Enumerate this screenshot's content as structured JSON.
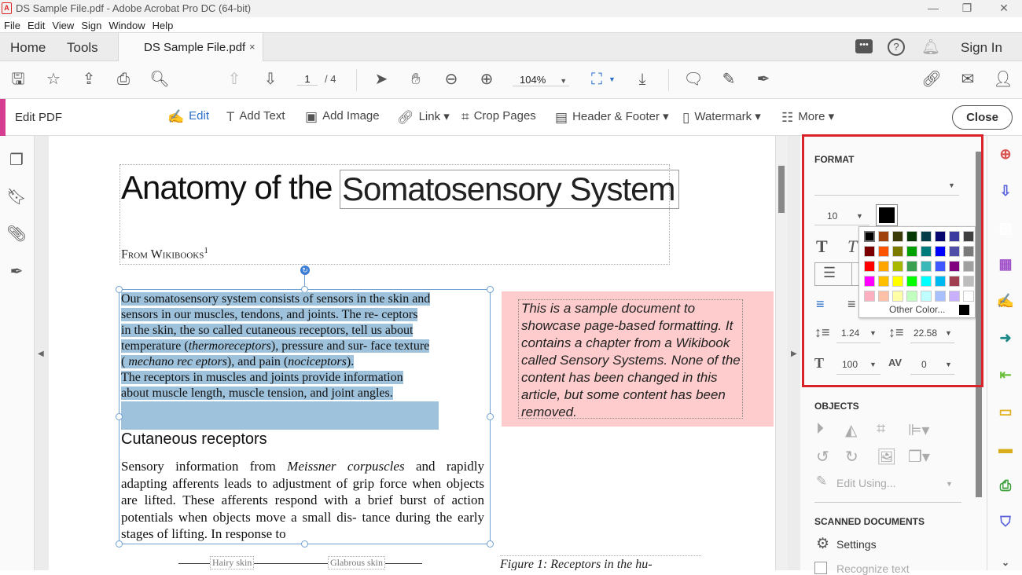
{
  "window": {
    "title": "DS Sample File.pdf - Adobe Acrobat Pro DC (64-bit)",
    "controls": [
      "minimize",
      "restore",
      "close"
    ]
  },
  "menu": [
    "File",
    "Edit",
    "View",
    "Sign",
    "Window",
    "Help"
  ],
  "tabs": {
    "home": "Home",
    "tools": "Tools",
    "document": "DS Sample File.pdf",
    "close_glyph": "×",
    "sign_in": "Sign In"
  },
  "toolbar": {
    "page_current": "1",
    "page_total": "/ 4",
    "zoom": "104%"
  },
  "edit_bar": {
    "title": "Edit PDF",
    "tools": [
      {
        "label": "Edit",
        "icon": "edit-icon",
        "active": true
      },
      {
        "label": "Add Text",
        "icon": "add-text-icon"
      },
      {
        "label": "Add Image",
        "icon": "add-image-icon"
      },
      {
        "label": "Link ▾",
        "icon": "link-icon"
      },
      {
        "label": "Crop Pages",
        "icon": "crop-pages-icon"
      },
      {
        "label": "Header & Footer ▾",
        "icon": "header-footer-icon"
      },
      {
        "label": "Watermark ▾",
        "icon": "watermark-icon"
      },
      {
        "label": "More ▾",
        "icon": "more-icon"
      }
    ],
    "close_label": "Close",
    "accent_color": "#d63c8f"
  },
  "document": {
    "title_part1": "Anatomy of the",
    "title_part2": "Somatosensory System",
    "byline": "From Wikibooks",
    "byline_sup": "1",
    "para1": {
      "l1": "Our somatosensory system consists of  sensors in the skin  and",
      "l2": "sensors in our  muscles, tendons, and  joints. The re- ceptors",
      "l3": "in the skin, the so  called cutaneous receptors,  tell  us about",
      "l4a": "temperature (",
      "l4i": "thermoreceptors",
      "l4b": "),  pressure and sur- face  texture",
      "l5a": "( ",
      "l5i": "mechano rec eptors",
      "l5b": "),  and  pain  (",
      "l5i2": "nociceptors",
      "l5c": ").",
      "l6": "The receptors in muscles and joints provide  information",
      "l7": "about muscle length, muscle   tension, and joint angles."
    },
    "heading2": "Cutaneous receptors",
    "para2": {
      "a": "Sensory information from ",
      "i": "Meissner corpuscles",
      "b": " and rapidly adapting afferents leads to adjustment of grip force when objects are lifted. These afferents respond with a brief burst of action potentials when objects move a small dis- tance during the early stages of lifting. In response to"
    },
    "sidenote": "This is a sample document to showcase page-based formatting. It contains a chapter from a Wikibook called Sensory Systems. None of the content has been changed in this article, but some content has been removed.",
    "figure_labels": [
      "Hairy skin",
      "Glabrous skin"
    ],
    "figure_caption": "Figure 1:  Receptors in the hu-"
  },
  "format_panel": {
    "heading": "FORMAT",
    "font_family": "",
    "font_size": "10",
    "text_color": "#000000",
    "palette": [
      [
        "#000000",
        "#a0410d",
        "#3b3b0a",
        "#063806",
        "#063b4a",
        "#06066e",
        "#3b3ba0",
        "#3f3f3f"
      ],
      [
        "#7a0000",
        "#ff5500",
        "#7a7a00",
        "#00a000",
        "#007a7a",
        "#0000ff",
        "#5050a8",
        "#7a7a7a"
      ],
      [
        "#ff0000",
        "#ffa500",
        "#a8b800",
        "#3aa050",
        "#3ab8b8",
        "#4058ff",
        "#800080",
        "#a0a0a0"
      ],
      [
        "#ff00ff",
        "#ffc000",
        "#ffff00",
        "#00ff00",
        "#00ffff",
        "#00b8f0",
        "#a04050",
        "#bdbdbd"
      ],
      [
        "#ffb0c0",
        "#ffc0a8",
        "#ffffa8",
        "#c0ffc0",
        "#c0ffff",
        "#a8c0ff",
        "#c8b0ff",
        "#ffffff"
      ]
    ],
    "other_color_label": "Other Color...",
    "line_spacing": "1.24",
    "paragraph_spacing": "22.58",
    "horizontal_scale": "100",
    "char_spacing": "0"
  },
  "objects_panel": {
    "heading": "OBJECTS",
    "edit_using": "Edit Using..."
  },
  "scanned_panel": {
    "heading": "SCANNED DOCUMENTS",
    "settings": "Settings",
    "recognize_text": "Recognize text"
  }
}
